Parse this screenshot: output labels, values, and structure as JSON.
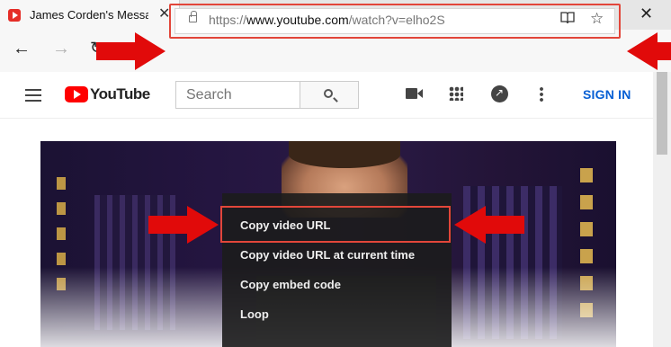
{
  "browser": {
    "tab_title": "James Corden's Messag",
    "tab_close_glyph": "✕",
    "new_tab_glyph": "+",
    "window_close_glyph": "✕",
    "nav": {
      "back_glyph": "←",
      "forward_glyph": "→",
      "refresh_glyph": "↻"
    },
    "address": {
      "scheme": "https://",
      "host": "www.youtube.com",
      "path": "/watch?v=elho2S"
    },
    "reader_glyph": "📖",
    "favorite_glyph": "☆"
  },
  "youtube": {
    "logo_text": "YouTube",
    "search_placeholder": "Search",
    "sign_in_label": "SIGN IN"
  },
  "context_menu": {
    "items": [
      {
        "label": "Copy video URL",
        "highlighted": true
      },
      {
        "label": "Copy video URL at current time",
        "highlighted": false
      },
      {
        "label": "Copy embed code",
        "highlighted": false
      },
      {
        "label": "Loop",
        "highlighted": false
      }
    ]
  },
  "annotation": {
    "arrow_color": "#e10a0a",
    "highlight_color": "#e2463a"
  },
  "icons": [
    "youtube-favicon",
    "close-icon",
    "plus-icon",
    "minimize-icon",
    "maximize-icon",
    "back-icon",
    "forward-icon",
    "refresh-icon",
    "lock-icon",
    "reader-view-icon",
    "star-icon",
    "hamburger-icon",
    "youtube-logo-icon",
    "search-icon",
    "create-video-icon",
    "apps-grid-icon",
    "messages-icon",
    "more-vertical-icon"
  ]
}
